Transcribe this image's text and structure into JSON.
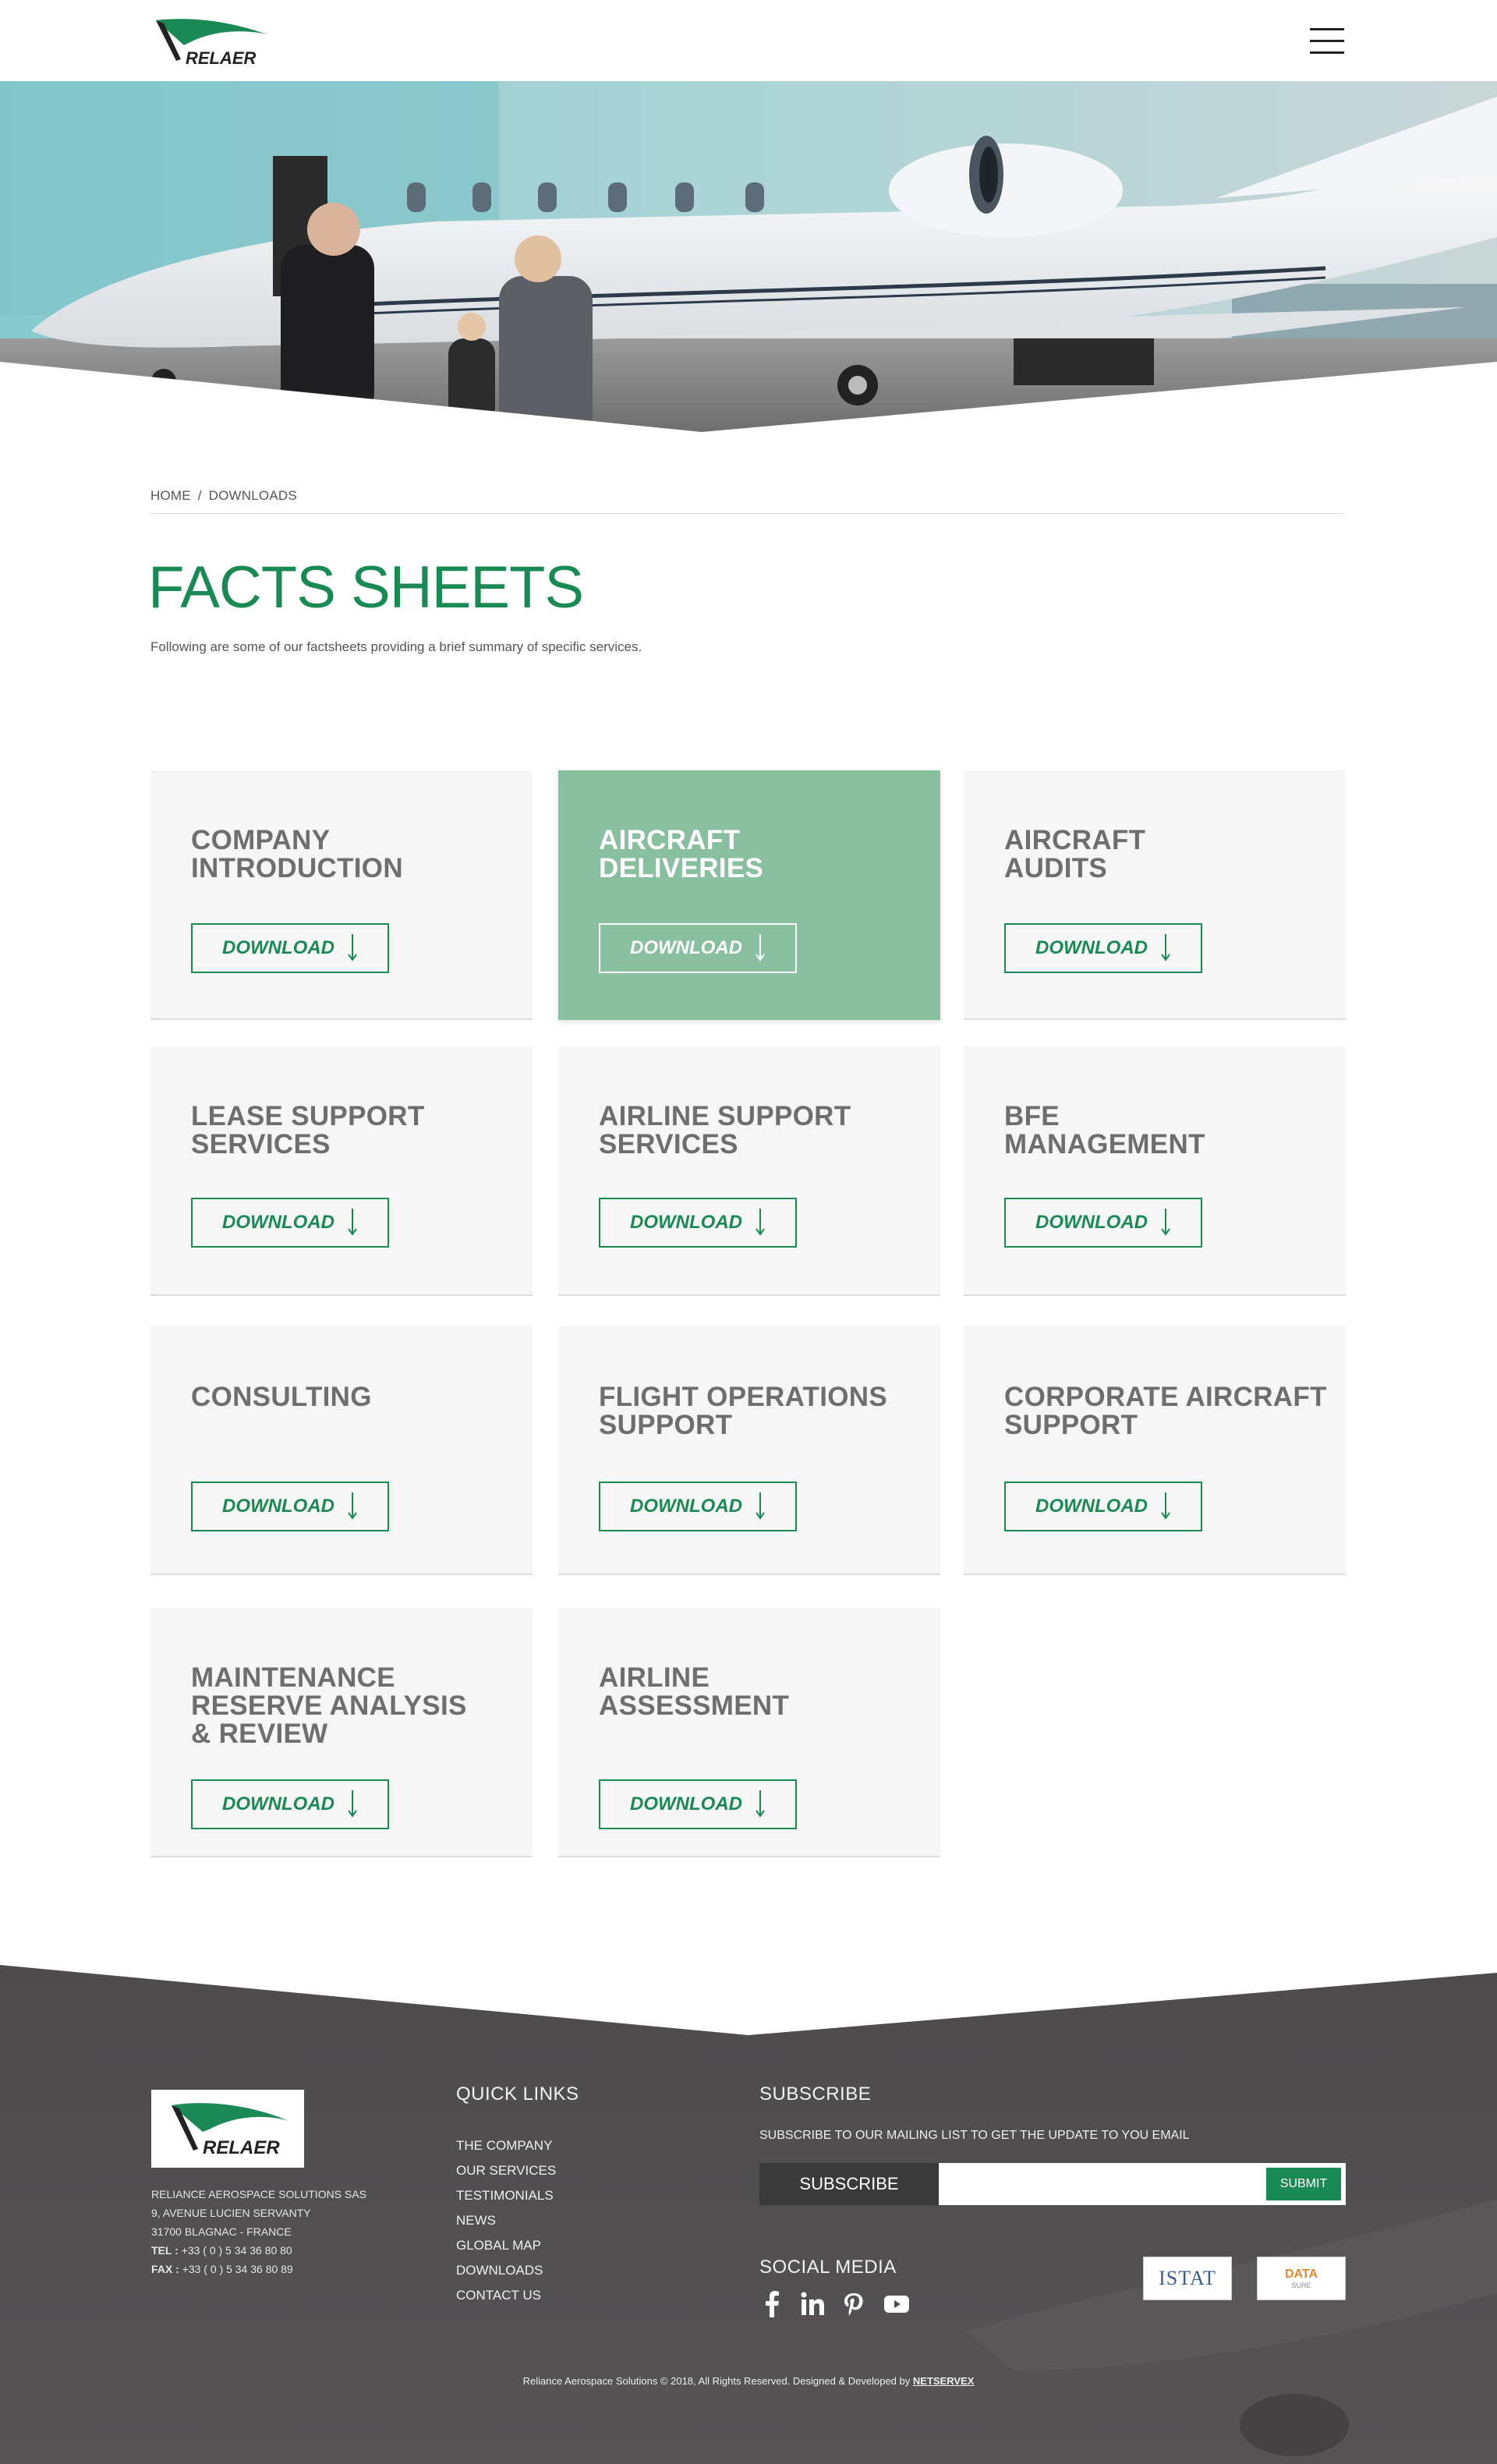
{
  "header": {
    "logo_text": "RELAER"
  },
  "breadcrumb": {
    "home": "HOME",
    "separator": "/",
    "current": "DOWNLOADS"
  },
  "page": {
    "title": "FACTS SHEETS",
    "intro": "Following are some of our factsheets providing a brief summary of specific services."
  },
  "cards": [
    {
      "title": "COMPANY\nINTRODUCTION",
      "button": "DOWNLOAD",
      "active": false
    },
    {
      "title": "AIRCRAFT\nDELIVERIES",
      "button": "DOWNLOAD",
      "active": true
    },
    {
      "title": "AIRCRAFT\nAUDITS",
      "button": "DOWNLOAD",
      "active": false
    },
    {
      "title": "LEASE SUPPORT\nSERVICES",
      "button": "DOWNLOAD",
      "active": false
    },
    {
      "title": "AIRLINE SUPPORT\nSERVICES",
      "button": "DOWNLOAD",
      "active": false
    },
    {
      "title": "BFE\nMANAGEMENT",
      "button": "DOWNLOAD",
      "active": false
    },
    {
      "title": "CONSULTING",
      "button": "DOWNLOAD",
      "active": false
    },
    {
      "title": "FLIGHT OPERATIONS\nSUPPORT",
      "button": "DOWNLOAD",
      "active": false
    },
    {
      "title": "CORPORATE AIRCRAFT\nSUPPORT",
      "button": "DOWNLOAD",
      "active": false
    },
    {
      "title": "MAINTENANCE\nRESERVE ANALYSIS\n& REVIEW",
      "button": "DOWNLOAD",
      "active": false
    },
    {
      "title": "AIRLINE\nASSESSMENT",
      "button": "DOWNLOAD",
      "active": false
    }
  ],
  "footer": {
    "logo_text": "RELAER",
    "company": {
      "name": "RELIANCE AEROSPACE SOLUTIONS SAS",
      "address1": "9, AVENUE LUCIEN SERVANTY",
      "address2": "31700 BLAGNAC - FRANCE",
      "tel_label": "TEL :",
      "tel": "+33 ( 0 ) 5 34 36 80 80",
      "fax_label": "FAX :",
      "fax": "+33 ( 0 ) 5 34 36 80 89"
    },
    "quick_links": {
      "heading": "QUICK LINKS",
      "items": [
        "THE COMPANY",
        "OUR SERVICES",
        "TESTIMONIALS",
        "NEWS",
        "GLOBAL MAP",
        "DOWNLOADS",
        "CONTACT US"
      ]
    },
    "subscribe": {
      "heading": "SUBSCRIBE",
      "text": "SUBSCRIBE TO OUR MAILING LIST TO GET THE UPDATE TO YOU EMAIL",
      "label": "SUBSCRIBE",
      "input_value": "",
      "submit": "SUBMIT"
    },
    "social": {
      "heading": "SOCIAL MEDIA",
      "icons": [
        "facebook-icon",
        "linkedin-icon",
        "pinterest-icon",
        "youtube-icon"
      ]
    },
    "partners": {
      "istat": "ISTAT",
      "datasure": "DATA",
      "datasure_sub": "SURE"
    },
    "copyright": "Reliance Aerospace Solutions © 2018, All Rights Reserved. Designed & Developed by",
    "developer": "NETSERVEX"
  },
  "colors": {
    "brand_green": "#1a8a55",
    "active_card": "#88bf9f",
    "card_bg": "#f6f6f6",
    "footer_bg": "#4a4849"
  }
}
